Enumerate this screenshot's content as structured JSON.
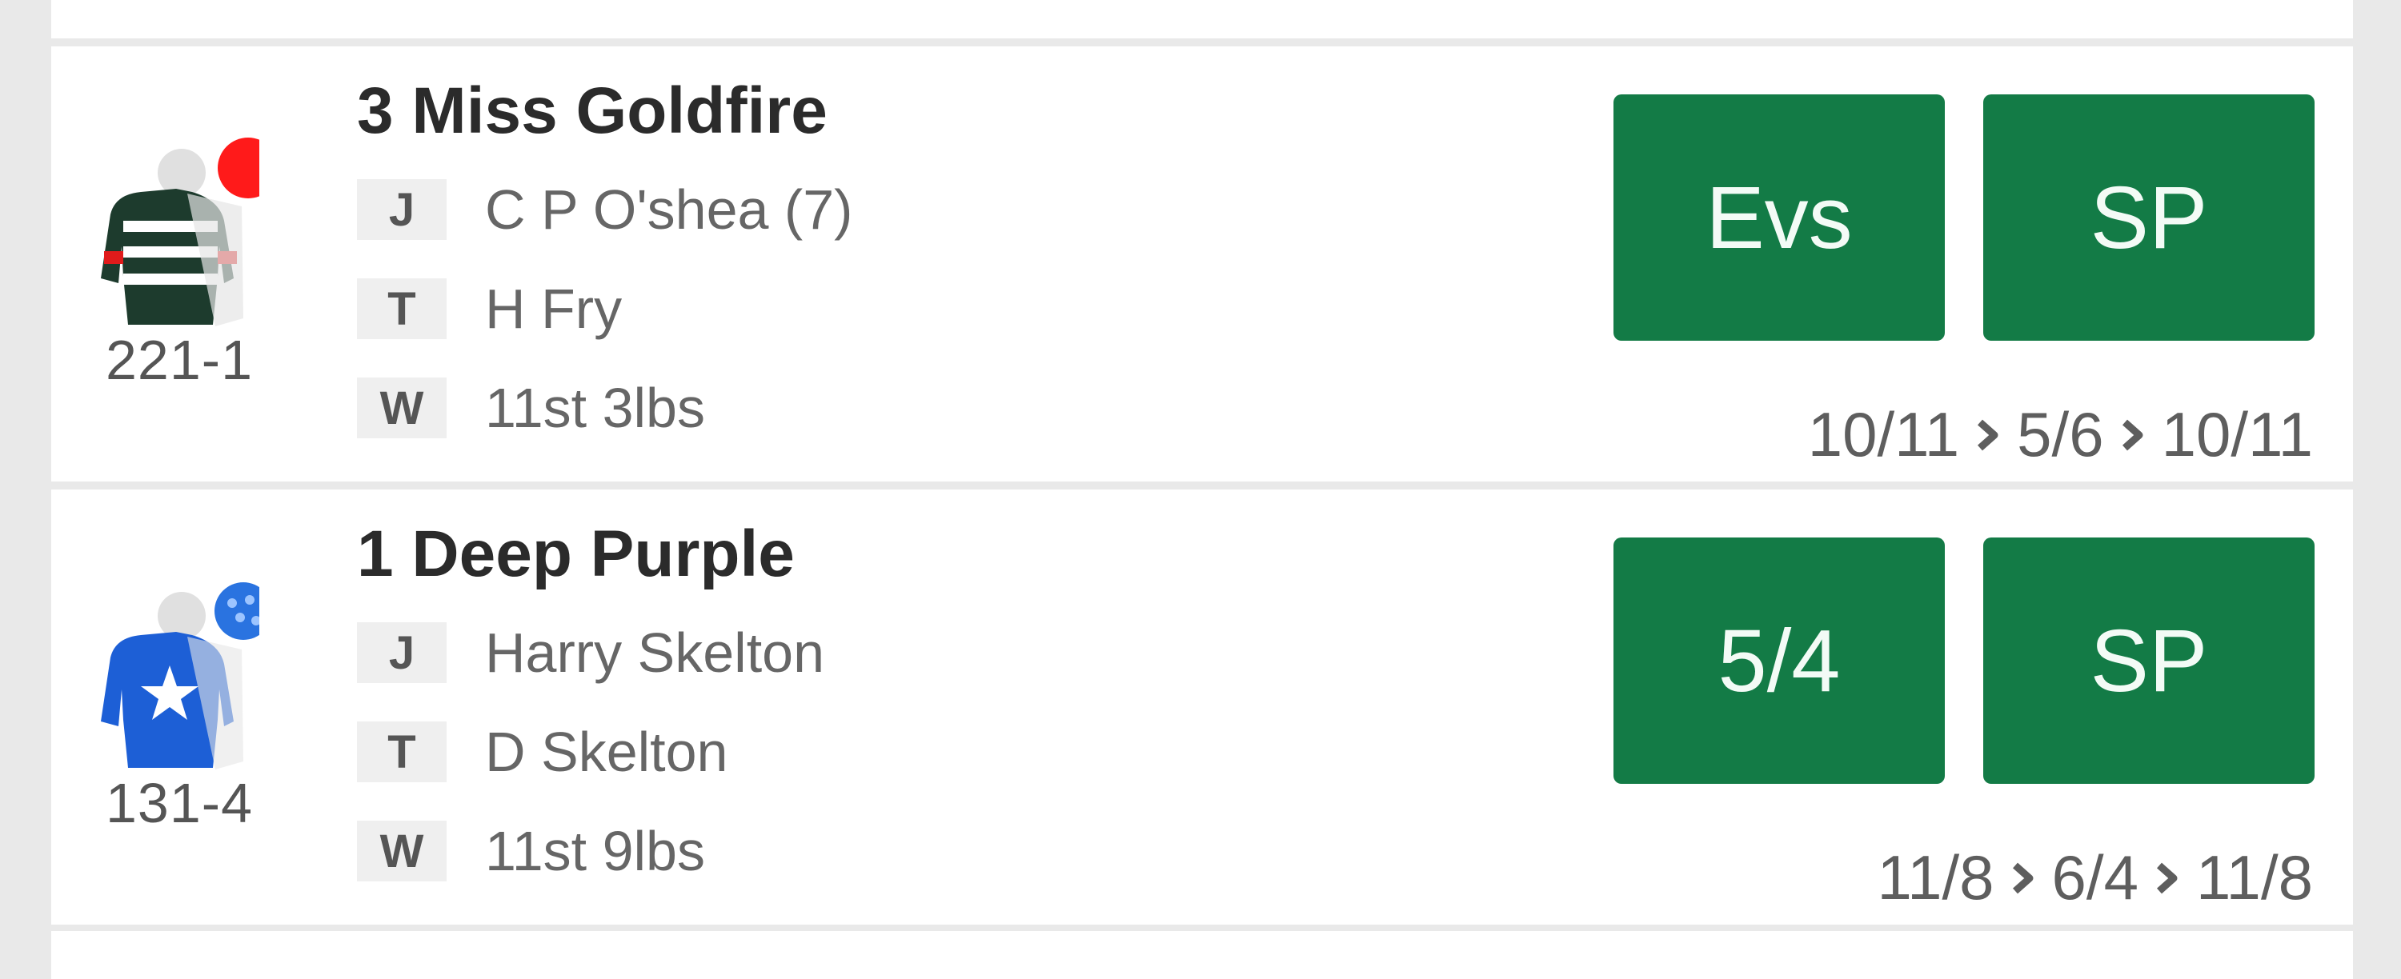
{
  "runners": [
    {
      "name": "3 Miss Goldfire",
      "form": "221-1",
      "jockey_tag": "J",
      "jockey": "C P O'shea (7)",
      "trainer_tag": "T",
      "trainer": "H Fry",
      "weight_tag": "W",
      "weight": "11st 3lbs",
      "price": "Evs",
      "sp": "SP",
      "history": [
        "10/11",
        "5/6",
        "10/11"
      ],
      "silks": {
        "body": "#1d3b2d",
        "stripe": "#ffffff",
        "cap": "#e0e0e0",
        "cap_spot": "#ff1a1a",
        "accent": "#e01b1b"
      }
    },
    {
      "name": "1 Deep Purple",
      "form": "131-4",
      "jockey_tag": "J",
      "jockey": "Harry Skelton",
      "trainer_tag": "T",
      "trainer": "D Skelton",
      "weight_tag": "W",
      "weight": "11st 9lbs",
      "price": "5/4",
      "sp": "SP",
      "history": [
        "11/8",
        "6/4",
        "11/8"
      ],
      "silks": {
        "body": "#1d5fd6",
        "star": "#ffffff",
        "cap": "#e0e0e0",
        "cap_spot": "#2a73e0"
      }
    }
  ],
  "colors": {
    "button": "#137b46",
    "button_text": "#f3fbf6",
    "chevron": "#5e5e5e"
  }
}
